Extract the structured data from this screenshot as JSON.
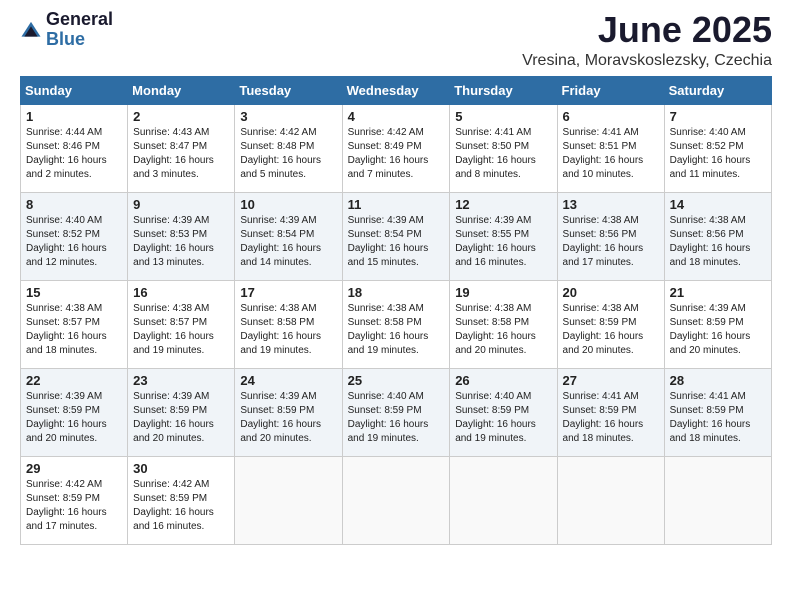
{
  "logo": {
    "general": "General",
    "blue": "Blue"
  },
  "title": "June 2025",
  "location": "Vresina, Moravskoslezsky, Czechia",
  "headers": [
    "Sunday",
    "Monday",
    "Tuesday",
    "Wednesday",
    "Thursday",
    "Friday",
    "Saturday"
  ],
  "weeks": [
    [
      {
        "day": "1",
        "sunrise": "4:44 AM",
        "sunset": "8:46 PM",
        "daylight": "16 hours and 2 minutes."
      },
      {
        "day": "2",
        "sunrise": "4:43 AM",
        "sunset": "8:47 PM",
        "daylight": "16 hours and 3 minutes."
      },
      {
        "day": "3",
        "sunrise": "4:42 AM",
        "sunset": "8:48 PM",
        "daylight": "16 hours and 5 minutes."
      },
      {
        "day": "4",
        "sunrise": "4:42 AM",
        "sunset": "8:49 PM",
        "daylight": "16 hours and 7 minutes."
      },
      {
        "day": "5",
        "sunrise": "4:41 AM",
        "sunset": "8:50 PM",
        "daylight": "16 hours and 8 minutes."
      },
      {
        "day": "6",
        "sunrise": "4:41 AM",
        "sunset": "8:51 PM",
        "daylight": "16 hours and 10 minutes."
      },
      {
        "day": "7",
        "sunrise": "4:40 AM",
        "sunset": "8:52 PM",
        "daylight": "16 hours and 11 minutes."
      }
    ],
    [
      {
        "day": "8",
        "sunrise": "4:40 AM",
        "sunset": "8:52 PM",
        "daylight": "16 hours and 12 minutes."
      },
      {
        "day": "9",
        "sunrise": "4:39 AM",
        "sunset": "8:53 PM",
        "daylight": "16 hours and 13 minutes."
      },
      {
        "day": "10",
        "sunrise": "4:39 AM",
        "sunset": "8:54 PM",
        "daylight": "16 hours and 14 minutes."
      },
      {
        "day": "11",
        "sunrise": "4:39 AM",
        "sunset": "8:54 PM",
        "daylight": "16 hours and 15 minutes."
      },
      {
        "day": "12",
        "sunrise": "4:39 AM",
        "sunset": "8:55 PM",
        "daylight": "16 hours and 16 minutes."
      },
      {
        "day": "13",
        "sunrise": "4:38 AM",
        "sunset": "8:56 PM",
        "daylight": "16 hours and 17 minutes."
      },
      {
        "day": "14",
        "sunrise": "4:38 AM",
        "sunset": "8:56 PM",
        "daylight": "16 hours and 18 minutes."
      }
    ],
    [
      {
        "day": "15",
        "sunrise": "4:38 AM",
        "sunset": "8:57 PM",
        "daylight": "16 hours and 18 minutes."
      },
      {
        "day": "16",
        "sunrise": "4:38 AM",
        "sunset": "8:57 PM",
        "daylight": "16 hours and 19 minutes."
      },
      {
        "day": "17",
        "sunrise": "4:38 AM",
        "sunset": "8:58 PM",
        "daylight": "16 hours and 19 minutes."
      },
      {
        "day": "18",
        "sunrise": "4:38 AM",
        "sunset": "8:58 PM",
        "daylight": "16 hours and 19 minutes."
      },
      {
        "day": "19",
        "sunrise": "4:38 AM",
        "sunset": "8:58 PM",
        "daylight": "16 hours and 20 minutes."
      },
      {
        "day": "20",
        "sunrise": "4:38 AM",
        "sunset": "8:59 PM",
        "daylight": "16 hours and 20 minutes."
      },
      {
        "day": "21",
        "sunrise": "4:39 AM",
        "sunset": "8:59 PM",
        "daylight": "16 hours and 20 minutes."
      }
    ],
    [
      {
        "day": "22",
        "sunrise": "4:39 AM",
        "sunset": "8:59 PM",
        "daylight": "16 hours and 20 minutes."
      },
      {
        "day": "23",
        "sunrise": "4:39 AM",
        "sunset": "8:59 PM",
        "daylight": "16 hours and 20 minutes."
      },
      {
        "day": "24",
        "sunrise": "4:39 AM",
        "sunset": "8:59 PM",
        "daylight": "16 hours and 20 minutes."
      },
      {
        "day": "25",
        "sunrise": "4:40 AM",
        "sunset": "8:59 PM",
        "daylight": "16 hours and 19 minutes."
      },
      {
        "day": "26",
        "sunrise": "4:40 AM",
        "sunset": "8:59 PM",
        "daylight": "16 hours and 19 minutes."
      },
      {
        "day": "27",
        "sunrise": "4:41 AM",
        "sunset": "8:59 PM",
        "daylight": "16 hours and 18 minutes."
      },
      {
        "day": "28",
        "sunrise": "4:41 AM",
        "sunset": "8:59 PM",
        "daylight": "16 hours and 18 minutes."
      }
    ],
    [
      {
        "day": "29",
        "sunrise": "4:42 AM",
        "sunset": "8:59 PM",
        "daylight": "16 hours and 17 minutes."
      },
      {
        "day": "30",
        "sunrise": "4:42 AM",
        "sunset": "8:59 PM",
        "daylight": "16 hours and 16 minutes."
      },
      null,
      null,
      null,
      null,
      null
    ]
  ]
}
